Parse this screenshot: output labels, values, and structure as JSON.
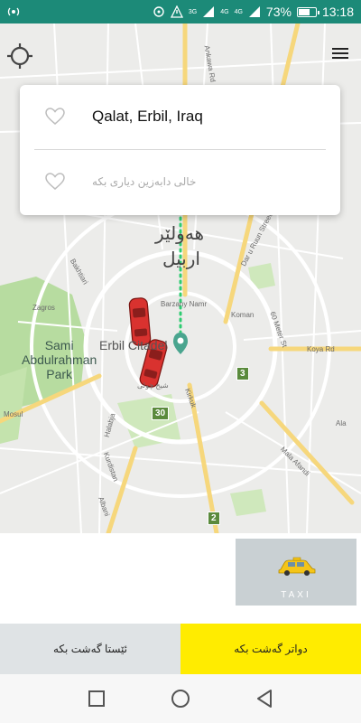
{
  "status_bar": {
    "battery_percent": "73%",
    "battery_level": 0.73,
    "time": "13:18",
    "network_labels": [
      "3G",
      "4G",
      "4G"
    ],
    "icons": [
      "hotspot-icon",
      "sync-icon",
      "alert-icon",
      "signal-icon",
      "signal-icon",
      "battery-icon"
    ]
  },
  "search": {
    "from_value": "Qalat, Erbil, Iraq",
    "to_placeholder": "خالی دابەزین دیاری بکە"
  },
  "map": {
    "city_label_kurdish_1": "هەولێر",
    "city_label_kurdish_2": "اربيل",
    "park_label_1": "Sami",
    "park_label_2": "Abdulrahman",
    "park_label_3": "Park",
    "center_label": "Erbil Citadel",
    "street_labels": {
      "ankawa": "Ankawa Rd",
      "dar_u_ruun": "Dar u Ruun Street",
      "bakhtiari": "Bakhtiari",
      "zagros": "Zagros",
      "barzany": "Barzany Namr",
      "koman": "Koman",
      "sixty_meter": "60 Meter St",
      "koya": "Koya Rd",
      "mosul": "Mosul",
      "kirkuk": "Kirkuk",
      "halab": "Halabja",
      "kurdistan": "Kurdistan",
      "mala_afandi": "Mala Afandi",
      "ala": "Ala",
      "albani": "Albani",
      "shekh": "شیخ چولی"
    },
    "shields": [
      "3",
      "30",
      "2"
    ]
  },
  "vehicle_option": {
    "label": "TAXI"
  },
  "buttons": {
    "now": "ئێستا گەشت بکە",
    "later": "دواتر گەشت بکە"
  },
  "colors": {
    "status_bar": "#1c8a78",
    "later_button": "#ffec00",
    "now_button": "#dfe3e5",
    "road_yellow": "#f6d77c",
    "park_green": "#b7dca0",
    "route_dots": "#2ecc71",
    "pin": "#4aa58f",
    "car": "#d9322f"
  }
}
